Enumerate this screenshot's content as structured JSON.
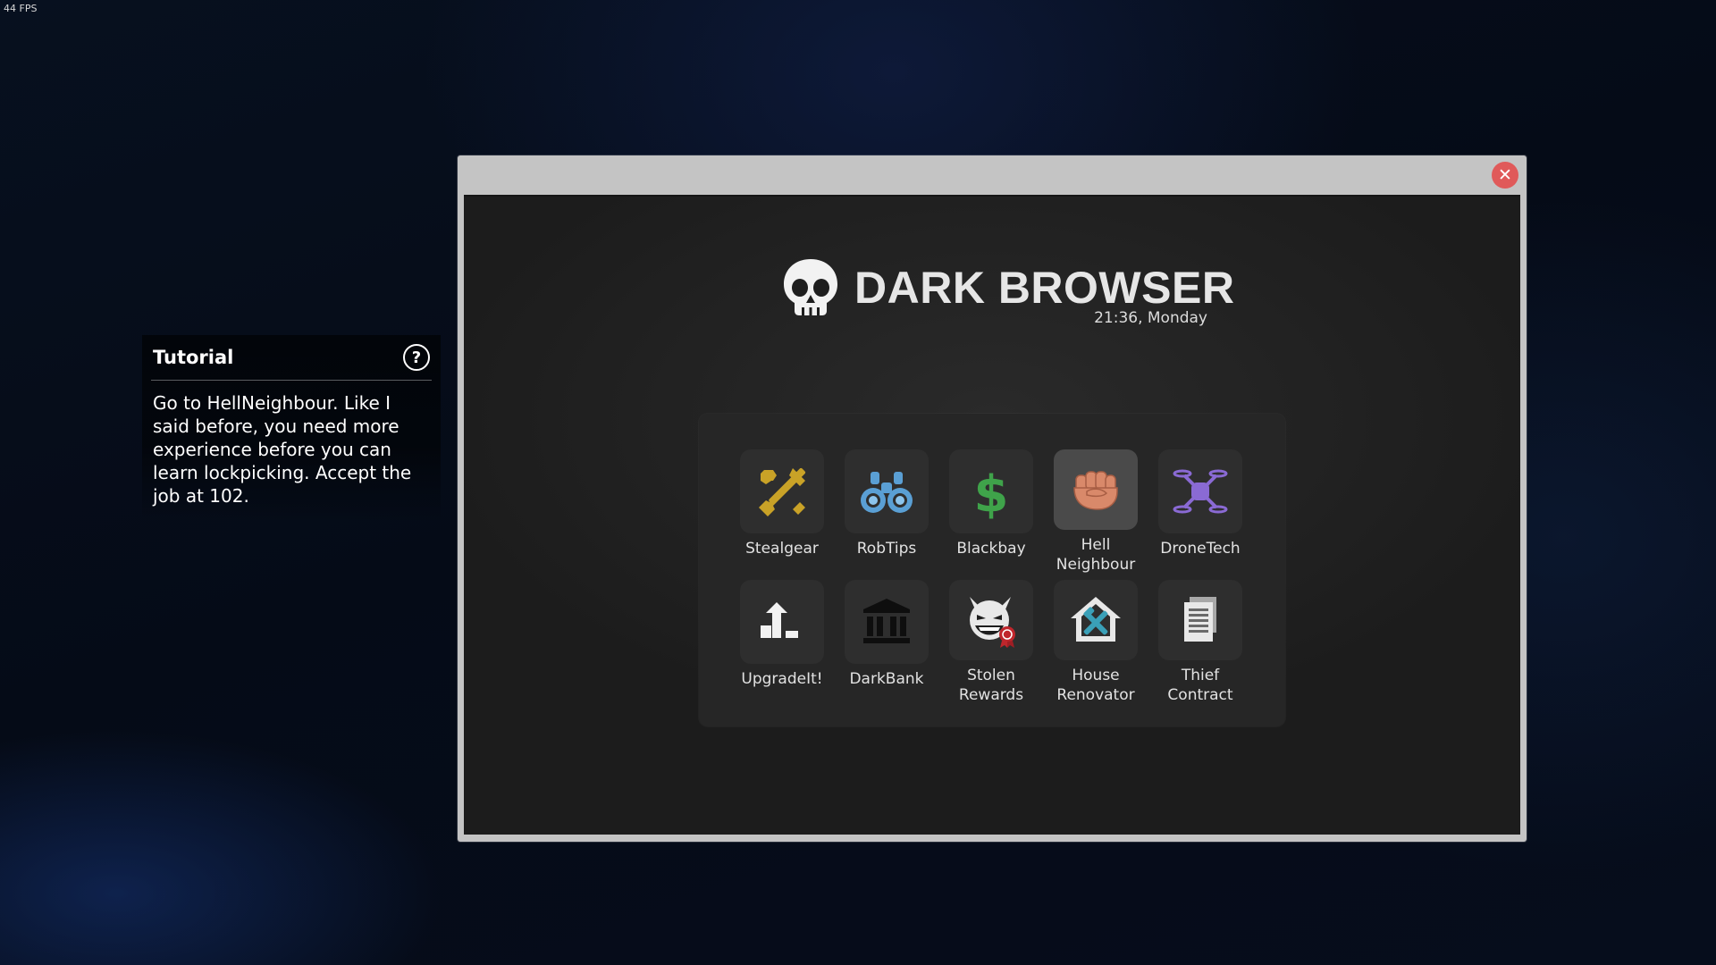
{
  "overlay": {
    "fps": "44 FPS"
  },
  "tutorial": {
    "title": "Tutorial",
    "help_icon": "question-circle-icon",
    "text": "Go to HellNeighbour. Like I said before, you need more experience before you can learn lockpicking. Accept the job at 102."
  },
  "window": {
    "close_label": "✕",
    "brand": {
      "title": "DARK BROWSER",
      "time": "21:36, Monday",
      "icon": "skull-icon"
    },
    "apps": [
      {
        "label": "Stealgear",
        "icon": "tools-icon"
      },
      {
        "label": "RobTips",
        "icon": "binoculars-icon"
      },
      {
        "label": "Blackbay",
        "icon": "dollar-icon"
      },
      {
        "label": "Hell\nNeighbour",
        "icon": "fist-icon",
        "selected": true
      },
      {
        "label": "DroneTech",
        "icon": "drone-icon"
      },
      {
        "label": "UpgradeIt!",
        "icon": "upgrade-icon"
      },
      {
        "label": "DarkBank",
        "icon": "bank-icon"
      },
      {
        "label": "Stolen\nRewards",
        "icon": "devil-badge-icon"
      },
      {
        "label": "House\nRenovator",
        "icon": "house-tools-icon"
      },
      {
        "label": "Thief\nContract",
        "icon": "document-icon"
      }
    ]
  },
  "colors": {
    "close_button": "#e05a5a",
    "stealgear_icon": "#c9a227",
    "robtips_icon": "#5a9fd4",
    "blackbay_icon": "#3fa34a",
    "hellneighbour_icon": "#d9896a",
    "dronetech_icon": "#8a6ad4",
    "house_renovator_icon": "#3aa0b8"
  }
}
